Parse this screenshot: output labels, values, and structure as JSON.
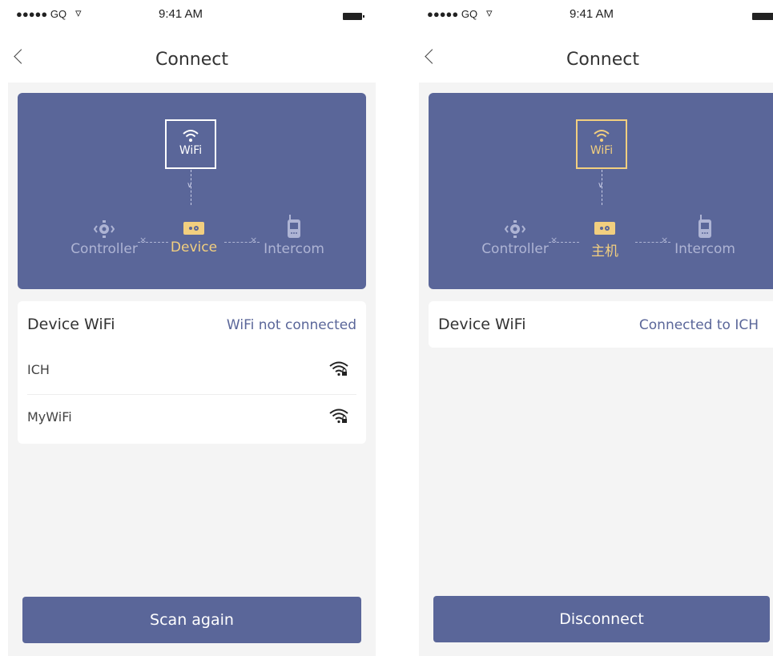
{
  "colors": {
    "panel": "#5a6699",
    "accent": "#f2cf7f",
    "muted": "#aeb4d4",
    "background": "#f4f4f4"
  },
  "screens": [
    {
      "status": {
        "signal": "●●●●● GQ",
        "time": "9:41 AM"
      },
      "title": "Connect",
      "diagram": {
        "wifi_label": "WiFi",
        "controller": "Controller",
        "device": "Device",
        "intercom": "Intercom"
      },
      "card": {
        "title": "Device WiFi",
        "status": "WiFi not connected"
      },
      "networks": [
        {
          "name": "ICH",
          "icon": "wifi-lock-icon"
        },
        {
          "name": "MyWiFi",
          "icon": "wifi-lock-icon"
        }
      ],
      "button": "Scan again"
    },
    {
      "status": {
        "signal": "●●●●● GQ",
        "time": "9:41 AM"
      },
      "title": "Connect",
      "diagram": {
        "wifi_label": "WiFi",
        "controller": "Controller",
        "device": "主机",
        "intercom": "Intercom"
      },
      "card": {
        "title": "Device WiFi",
        "status": "Connected to ICH"
      },
      "button": "Disconnect"
    }
  ]
}
